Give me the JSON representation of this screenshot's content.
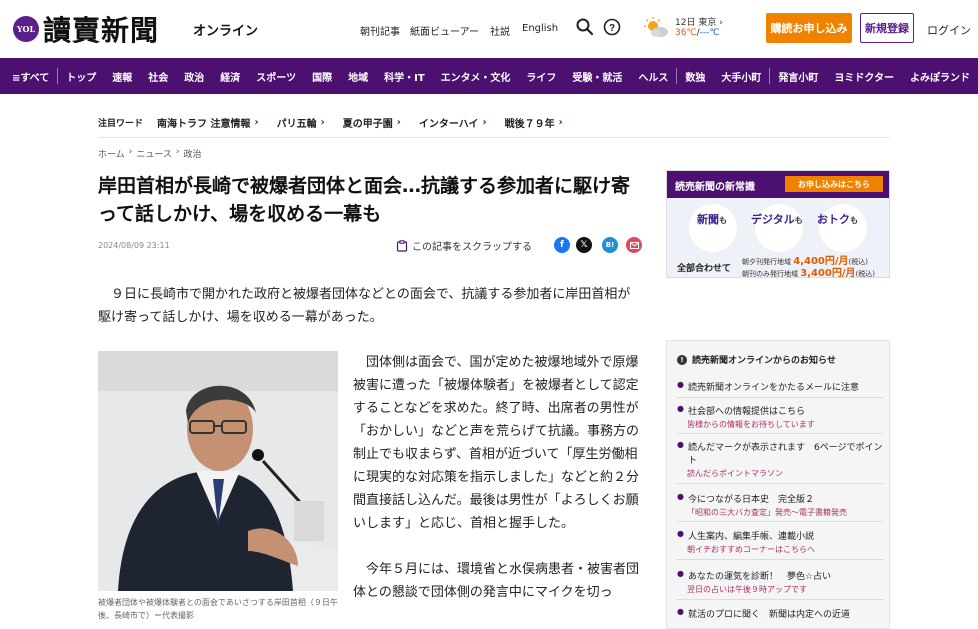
{
  "header": {
    "logo_badge": "YOL",
    "logo": "讀賣新聞",
    "logo_suffix": "オンライン",
    "nav": [
      "朝刊記事",
      "紙面ビューアー",
      "社説",
      "English"
    ],
    "weather": {
      "date": "12日 東京",
      "high": "36℃",
      "low": "---℃"
    },
    "subscribe_label": "購読お申し込み",
    "register_label": "新規登録",
    "login_label": "ログイン"
  },
  "mainnav": {
    "all_label": "≡すべて",
    "items": [
      "トップ",
      "速報",
      "社会",
      "政治",
      "経済",
      "スポーツ",
      "国際",
      "地域",
      "科学・IT",
      "エンタメ・文化",
      "ライフ",
      "受験・就活",
      "ヘルス"
    ],
    "extra": [
      "数独",
      "大手小町",
      "発言小町",
      "ヨミドクター",
      "よみぽランド"
    ]
  },
  "trends": {
    "title": "注目ワード",
    "tags": [
      "南海トラフ 注意情報",
      "パリ五輪",
      "夏の甲子園",
      "インターハイ",
      "戦後７９年"
    ]
  },
  "breadcrumb": [
    "ホーム",
    "ニュース",
    "政治"
  ],
  "article": {
    "headline": "岸田首相が長崎で被爆者団体と面会…抗議する参加者に駆け寄って話しかけ、場を収める一幕も",
    "date": "2024/08/09 23:11",
    "scrap_label": "この記事をスクラップする",
    "lead": "９日に長崎市で開かれた政府と被爆者団体などとの面会で、抗議する参加者に岸田首相が駆け寄って話しかけ、場を収める一幕があった。",
    "body": [
      "団体側は面会で、国が定めた被爆地域外で原爆被害に遭った「被爆体験者」を被爆者として認定することなどを求めた。終了時、出席者の男性が「おかしい」などと声を荒らげて抗議。事務方の制止でも収まらず、首相が近づいて「厚生労働相に現実的な対応策を指示しました」などと約２分間直接話し込んだ。最後は男性が「よろしくお願いします」と応じ、首相と握手した。",
      "今年５月には、環境省と水俣病患者・被害者団体との懇談で団体側の発言中にマイクを切っ"
    ],
    "caption": "被爆者団体や被爆体験者との面会であいさつする岸田首相（９日午後、長崎市で）＝代表撮影"
  },
  "ad": {
    "title": "読売新聞の新常識",
    "apply": "お申し込みはこちら",
    "labels": [
      {
        "main": "新聞",
        "suffix": "も"
      },
      {
        "main": "デジタル",
        "suffix": "も"
      },
      {
        "main": "おトク",
        "suffix": "も"
      }
    ],
    "bundle": "全部合わせて",
    "price1_label": "朝夕刊発行地域",
    "price1": "4,400",
    "price2_label": "朝刊のみ発行地域",
    "price2": "3,400",
    "unit": "円/月",
    "tax": "(税込)"
  },
  "notice": {
    "title": "読売新聞オンラインからのお知らせ",
    "items": [
      {
        "main": "読売新聞オンラインをかたるメールに注意",
        "sub": ""
      },
      {
        "main": "社会部への情報提供はこちら",
        "sub": "皆様からの情報をお待ちしています"
      },
      {
        "main": "読んだマークが表示されます　6ページでポイント",
        "sub": "読んだらポイントマラソン"
      },
      {
        "main": "今につながる日本史　完全版２",
        "sub": "「昭和の三大バカ査定」発売～電子書籍発売"
      },
      {
        "main": "人生案内、編集手帳、連載小説",
        "sub": "朝イチおすすめコーナーはこちらへ"
      },
      {
        "main": "あなたの運気を診断！　夢色☆占い",
        "sub": "翌日の占いは午後９時アップです"
      },
      {
        "main": "就活のプロに聞く　新聞は内定への近道",
        "sub": ""
      }
    ]
  },
  "colors": {
    "brand": "#4b1070",
    "accent": "#f08200"
  }
}
